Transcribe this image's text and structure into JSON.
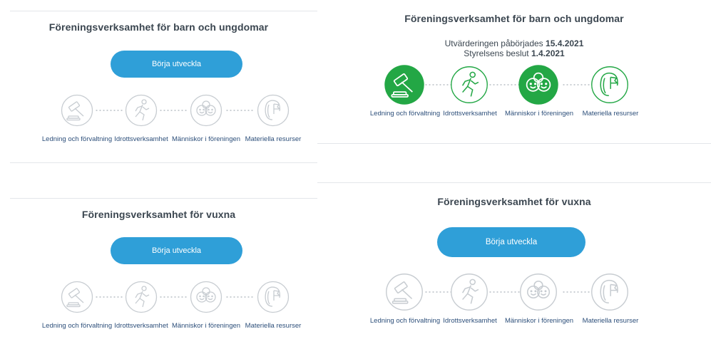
{
  "icons": [
    "gavel-icon",
    "runner-icon",
    "smiley-faces-icon",
    "carabiner-flag-icon"
  ],
  "colors": {
    "accent": "#2f9fd8",
    "completed": "#23a745",
    "inactive_stroke": "#c7ccd1",
    "label": "#2d4f7a",
    "title": "#3b4650"
  },
  "panels": [
    {
      "title": "Föreningsverksamhet för barn och ungdomar",
      "button_label": "Börja utveckla",
      "steps": [
        {
          "label": "Ledning och förvaltning"
        },
        {
          "label": "Idrottsverksamhet"
        },
        {
          "label": "Människor i föreningen"
        },
        {
          "label": "Materiella resurser"
        }
      ]
    },
    {
      "title": "Föreningsverksamhet för barn och ungdomar",
      "started_prefix": "Utvärderingen påbörjades",
      "started_date": "15.4.2021",
      "decision_prefix": "Styrelsens beslut",
      "decision_date": "1.4.2021",
      "steps": [
        {
          "label": "Ledning och förvaltning",
          "status": "completed"
        },
        {
          "label": "Idrottsverksamhet",
          "status": "in-progress"
        },
        {
          "label": "Människor i föreningen",
          "status": "completed"
        },
        {
          "label": "Materiella resurser",
          "status": "in-progress"
        }
      ]
    },
    {
      "title": "Föreningsverksamhet för vuxna",
      "button_label": "Börja utveckla",
      "steps": [
        {
          "label": "Ledning och förvaltning"
        },
        {
          "label": "Idrottsverksamhet"
        },
        {
          "label": "Människor i föreningen"
        },
        {
          "label": "Materiella resurser"
        }
      ]
    },
    {
      "title": "Föreningsverksamhet för vuxna",
      "button_label": "Börja utveckla",
      "steps": [
        {
          "label": "Ledning och förvaltning"
        },
        {
          "label": "Idrottsverksamhet"
        },
        {
          "label": "Människor i föreningen"
        },
        {
          "label": "Materiella resurser"
        }
      ]
    }
  ]
}
